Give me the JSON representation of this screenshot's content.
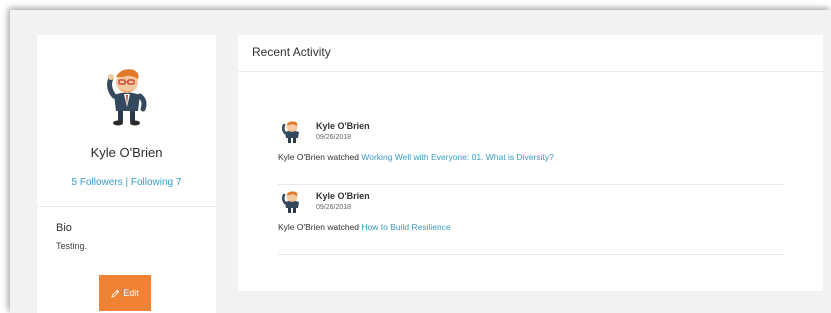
{
  "profile": {
    "name": "Kyle O'Brien",
    "followers": "5 Followers",
    "separator": "|",
    "following": "Following 7",
    "bio_title": "Bio",
    "bio_text": "Testing.",
    "edit_label": "Edit",
    "edit_icon": "pencil-icon",
    "accent_color": "#f08233",
    "link_color": "#3a9bc9"
  },
  "activity": {
    "title": "Recent Activity",
    "items": [
      {
        "user": "Kyle O'Brien",
        "date": "09/26/2018",
        "action_prefix": "Kyle O'Brien watched",
        "link": "Working Well with Everyone: 01. What is Diversity?"
      },
      {
        "user": "Kyle O'Brien",
        "date": "09/26/2018",
        "action_prefix": "Kyle O'Brien watched",
        "link": "How to Build Resilience"
      }
    ]
  }
}
